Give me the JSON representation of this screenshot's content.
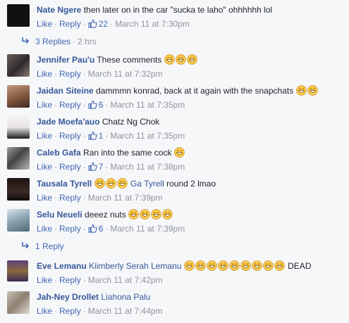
{
  "actions": {
    "like": "Like",
    "reply": "Reply",
    "dot": "·"
  },
  "comments": [
    {
      "author": "Nate Ngere",
      "text": "then later on in the car \"sucka te laho\" ohhhhhh lol",
      "likes": "22",
      "time": "March 11 at 7:30pm"
    },
    {
      "author": "Jennifer Pau'u",
      "text": "These comments",
      "time": "March 11 at 7:32pm"
    },
    {
      "author": "Jaidan Siteine",
      "text": "dammmn konrad, back at it again with the snapchats",
      "likes": "6",
      "time": "March 11 at 7:35pm"
    },
    {
      "author": "Jade Moefa'auo",
      "text": "Chatz Ng Chok",
      "likes": "1",
      "time": "March 11 at 7:35pm"
    },
    {
      "author": "Caleb Gafa",
      "text": "Ran into the same cock",
      "likes": "7",
      "time": "March 11 at 7:38pm"
    },
    {
      "author": "Tausala Tyrell",
      "mention": "Ga Tyrell",
      "text": "round 2 lmao",
      "time": "March 11 at 7:39pm"
    },
    {
      "author": "Selu Neueli",
      "text": "deeez nuts",
      "likes": "6",
      "time": "March 11 at 7:39pm"
    },
    {
      "author": "Eve Lemanu",
      "mention": "Kiimberly Serah Lemanu",
      "text": "DEAD",
      "time": "March 11 at 7:42pm"
    },
    {
      "author": "Jah-Ney Drollet",
      "mention": "Liahona Palu",
      "time": "March 11 at 7:44pm"
    }
  ],
  "reply_links": [
    {
      "label": "3 Replies",
      "age": "2 hrs"
    },
    {
      "label": "1 Reply"
    }
  ],
  "icons": {
    "emoji": "grinning-face-icon",
    "like": "thumbs-up-icon",
    "reply": "reply-arrow-icon"
  },
  "colors": {
    "link": "#4267b2",
    "author": "#365899",
    "muted": "#90949c",
    "background": "#f6f7f9",
    "emoji": "#ffcc4d"
  }
}
